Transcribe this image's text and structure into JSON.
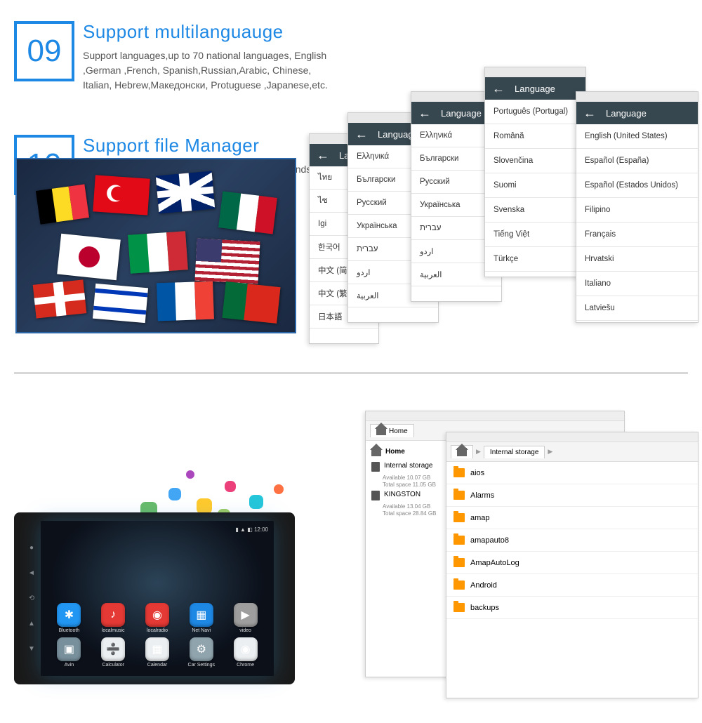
{
  "section1": {
    "badge": "09",
    "title": "Support multilanguauge",
    "desc": "Support languages,up to 70 national languages, English ,German ,French, Spanish,Russian,Arabic, Chinese, Italian, Hebrew,Македонски, Protuguese ,Japanese,etc."
  },
  "section2": {
    "badge": "10",
    "title": "Support file Manager",
    "desc": "Support download ,install and delete over thousands of android apps."
  },
  "langHeader": "Language",
  "langLists": {
    "w1": [
      "ไทย",
      "ไซ",
      "Igi",
      "한국어",
      "中文 (简体)",
      "中文 (繁體)",
      "日本語"
    ],
    "w2": [
      "Ελληνικά",
      "Български",
      "Русский",
      "Українська",
      "עברית",
      "اردو",
      "العربية"
    ],
    "w3": [
      "Ελληνικά",
      "Български",
      "Русский",
      "Українська",
      "עברית",
      "اردو",
      "العربية"
    ],
    "w4": [
      "Português (Portugal)",
      "Română",
      "Slovenčina",
      "Suomi",
      "Svenska",
      "Tiếng Việt",
      "Türkçe"
    ],
    "w5": [
      "English (United States)",
      "Español (España)",
      "Español (Estados Unidos)",
      "Filipino",
      "Français",
      "Hrvatski",
      "Italiano",
      "Latviešu"
    ]
  },
  "apps": [
    {
      "label": "Bluetooth",
      "color": "#2196f3",
      "glyph": "✱"
    },
    {
      "label": "localmusic",
      "color": "#e53935",
      "glyph": "♪"
    },
    {
      "label": "localradio",
      "color": "#e53935",
      "glyph": "◉"
    },
    {
      "label": "Net Navi",
      "color": "#1e88e5",
      "glyph": "▦"
    },
    {
      "label": "video",
      "color": "#9e9e9e",
      "glyph": "▶"
    },
    {
      "label": "Avin",
      "color": "#78909c",
      "glyph": "▣"
    },
    {
      "label": "Calculator",
      "color": "#eceff1",
      "glyph": "➗"
    },
    {
      "label": "Calendar",
      "color": "#eceff1",
      "glyph": "▦"
    },
    {
      "label": "Car Settings",
      "color": "#90a4ae",
      "glyph": "⚙"
    },
    {
      "label": "Chrome",
      "color": "#eceff1",
      "glyph": "◉"
    }
  ],
  "fm": {
    "homeTab": "Home",
    "internalTab": "Internal storage",
    "side": {
      "home": "Home",
      "internal": "Internal storage",
      "internalSub1": "Available 10.07 GB",
      "internalSub2": "Total space 11.05 GB",
      "kingston": "KINGSTON",
      "kingstonSub1": "Available 13.04 GB",
      "kingstonSub2": "Total space 28.84 GB"
    },
    "folders": [
      "aios",
      "Alarms",
      "amap",
      "amapauto8",
      "AmapAutoLog",
      "Android",
      "backups"
    ]
  }
}
